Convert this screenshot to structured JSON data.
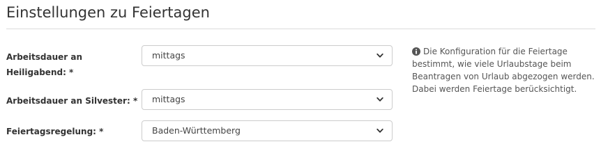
{
  "section": {
    "title": "Einstellungen zu Feiertagen"
  },
  "fields": [
    {
      "label": "Arbeitsdauer an Heiligabend: *",
      "value": "mittags"
    },
    {
      "label": "Arbeitsdauer an Silvester: *",
      "value": "mittags"
    },
    {
      "label": "Feiertagsregelung: *",
      "value": "Baden-Württemberg"
    }
  ],
  "info": {
    "icon": "info-circle-icon",
    "text": "Die Konfiguration für die Feiertage bestimmt, wie viele Urlaubstage beim Beantragen von Urlaub abgezogen werden. Dabei werden Feiertage berücksichtigt."
  },
  "colors": {
    "text": "#333333",
    "border": "#cccccc",
    "divider": "#dcdcdc",
    "info_text": "#555555"
  }
}
